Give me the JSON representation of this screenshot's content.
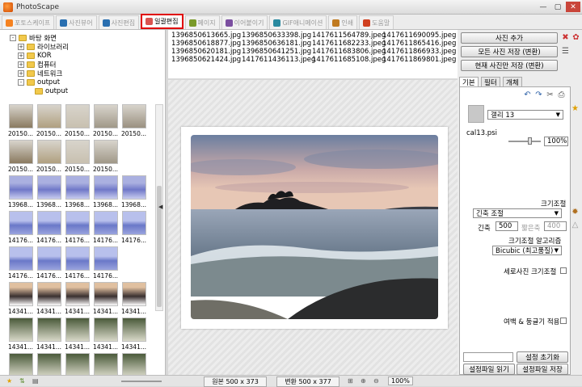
{
  "window": {
    "title": "PhotoScape"
  },
  "tabs": [
    {
      "label": "포토스케이프",
      "active": false
    },
    {
      "label": "사진뷰어",
      "active": false
    },
    {
      "label": "사진편집",
      "active": false
    },
    {
      "label": "일괄편집",
      "active": true
    },
    {
      "label": "페이지",
      "active": false
    },
    {
      "label": "이어붙이기",
      "active": false
    },
    {
      "label": "GIF애니메이션",
      "active": false
    },
    {
      "label": "인쇄",
      "active": false
    },
    {
      "label": "도움말",
      "active": false
    }
  ],
  "tree": [
    {
      "label": "바탕 화면",
      "indent": 0,
      "expander": "-"
    },
    {
      "label": "라이브러리",
      "indent": 1,
      "expander": "+"
    },
    {
      "label": "KOR",
      "indent": 1,
      "expander": "+"
    },
    {
      "label": "컴퓨터",
      "indent": 1,
      "expander": "+"
    },
    {
      "label": "네트워크",
      "indent": 1,
      "expander": "+"
    },
    {
      "label": "output",
      "indent": 1,
      "expander": "-"
    },
    {
      "label": "output",
      "indent": 2,
      "expander": ""
    }
  ],
  "thumbnails": [
    "20150...",
    "20150...",
    "20150...",
    "20150...",
    "20150...",
    "20150...",
    "20150...",
    "20150...",
    "20150...",
    "",
    "13968...",
    "13968...",
    "13968...",
    "13968...",
    "13968...",
    "14176...",
    "14176...",
    "14176...",
    "14176...",
    "14176...",
    "14176...",
    "14176...",
    "14176...",
    "14176...",
    "",
    "14341...",
    "14341...",
    "14341...",
    "14341...",
    "14341...",
    "14341...",
    "14341...",
    "14341...",
    "14341...",
    "14341...",
    "14341...",
    "14341...",
    "14341...",
    "14341...",
    "14341..."
  ],
  "file_list": [
    [
      "1396850613665.jpg",
      "1396850633398.jpg",
      "1417611564789.jpeg",
      "1417611690095.jpeg"
    ],
    [
      "1396850618877.jpg",
      "1396850636181.jpg",
      "1417611682233.jpeg",
      "1417611865416.jpeg"
    ],
    [
      "1396850620181.jpg",
      "1396850641251.jpg",
      "1417611683806.jpeg",
      "1417611866933.jpeg"
    ],
    [
      "1396850621424.jpg",
      "1417611436113.jpeg",
      "1417611685108.jpeg",
      "1417611869801.jpeg"
    ]
  ],
  "status": {
    "original": "원본 500 x 373",
    "converted": "변환 500 x 377",
    "zoom": "100%"
  },
  "right": {
    "add_photo": "사진 추가",
    "save_all": "모든 사진 저장 (변환)",
    "save_current": "현재 사진만 저장 (변환)",
    "tabs": [
      "기본",
      "필터",
      "개체"
    ],
    "frame_select": "갤리 13",
    "frame_file": "cal13.psi",
    "frame_percent": "100%",
    "resize_header": "크기조절",
    "resize_mode": "긴축 조절",
    "long_label": "긴축",
    "long_value": "500",
    "short_label": "짧은축",
    "short_value": "400",
    "algo_label": "크기조절 알고리즘",
    "algo_value": "Bicubic (최고품질)",
    "portrait_label": "세로사진 크기조절",
    "margin_label": "여백 & 둥글기 적용",
    "reset_settings": "설정 초기화",
    "load_settings": "설정파일 읽기",
    "save_settings": "설정파일 저장"
  }
}
